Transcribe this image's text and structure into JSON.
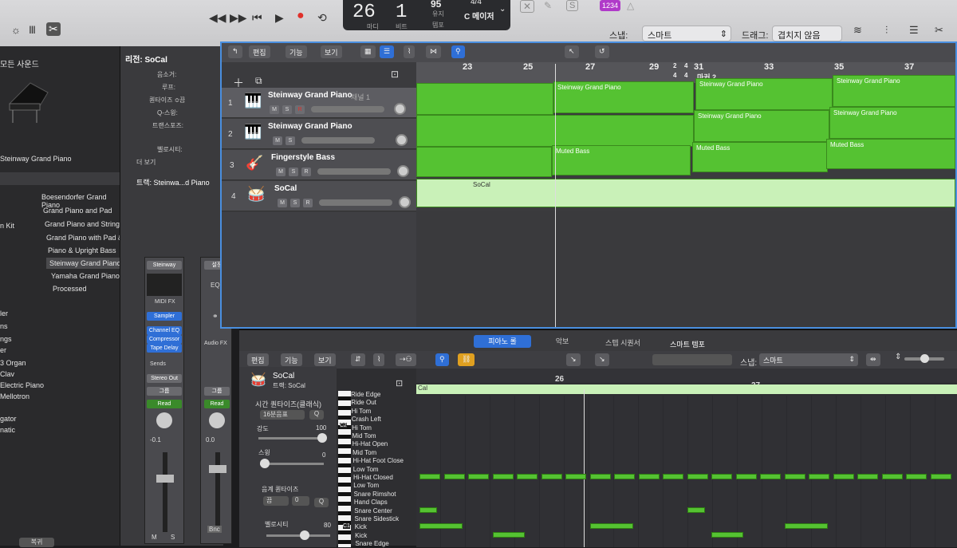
{
  "transport": {
    "bar": "26",
    "beat": "1",
    "bar_label": "마디",
    "beat_label": "비트",
    "tempo": "95",
    "tempo_label": "템포",
    "keep_label": "유지",
    "signature": "4/4",
    "key": "C 메이저",
    "counter": "1234"
  },
  "toolbar_right": {
    "snap_label": "스냅:",
    "snap_value": "스마트",
    "drag_label": "드래그:",
    "drag_value": "겹치지 않음"
  },
  "library": {
    "header": "모든 사운드",
    "instrument_name": "Steinway Grand Piano",
    "items": [
      {
        "label": "Boesendorfer Grand Piano"
      },
      {
        "label": "Grand Piano and Pad"
      },
      {
        "label": "Grand Piano and Strings"
      },
      {
        "label": "Grand Piano with Pad & C..."
      },
      {
        "label": "Piano & Upright Bass"
      },
      {
        "label": "Steinway Grand Piano"
      },
      {
        "label": "Yamaha Grand Piano"
      },
      {
        "label": "Processed"
      }
    ],
    "left_fragments": [
      "n Kit",
      "ler",
      "ns",
      "ngs",
      "er",
      "3 Organ",
      "Clav",
      "Electric Piano",
      "Mellotron",
      "gator",
      "natic"
    ],
    "footer": "복귀"
  },
  "inspector": {
    "region_title": "리전: SoCal",
    "mute": "음소거:",
    "loop": "루프:",
    "quantize": "퀀타이즈 ≎",
    "quantize_value": "끔",
    "q_swing": "Q-스윙:",
    "transpose": "트랜스포즈:",
    "velocity": "벨로시티:",
    "more": "더 보기",
    "track_title": "트랙: Steinwa...d Piano",
    "plugin_name": "Steinway",
    "settings": "설정",
    "eq": "EQ",
    "midi_fx": "MIDI FX",
    "sampler": "Sampler",
    "fx": [
      "Channel EQ",
      "Compressor",
      "Tape Delay"
    ],
    "audio_fx": "Audio FX",
    "sends": "Sends",
    "stereo_out": "Stereo Out",
    "group": "그룹",
    "read": "Read",
    "pan_a": "-0.1",
    "pan_b": "0.0",
    "bnc": "Bnc",
    "m": "M",
    "s": "S"
  },
  "tracks_window": {
    "menu": [
      "편집",
      "기능",
      "보기"
    ],
    "ruler": [
      "23",
      "25",
      "27",
      "29",
      "31",
      "33",
      "35",
      "37"
    ],
    "marker": "마커 2",
    "signature_marks": [
      "2",
      "4",
      "4",
      "4"
    ],
    "tracks": [
      {
        "num": "1",
        "name": "Steinway Grand Piano",
        "sub": "채널 1",
        "regions": [
          "Steinway Grand Piano",
          "Steinway Grand Piano",
          "Steinway Grand Piano"
        ]
      },
      {
        "num": "2",
        "name": "Steinway Grand Piano",
        "regions": [
          "Steinway Grand Piano",
          "Steinway Grand Piano"
        ]
      },
      {
        "num": "3",
        "name": "Fingerstyle Bass",
        "regions": [
          "Muted Bass",
          "Muted Bass",
          "Muted Bass"
        ]
      },
      {
        "num": "4",
        "name": "SoCal",
        "regions": [
          "SoCal"
        ]
      }
    ],
    "msr": [
      "M",
      "S",
      "R"
    ]
  },
  "editor": {
    "tabs": [
      "피아노 롤",
      "악보",
      "스텝 시퀀서",
      "스마트 템포"
    ],
    "menu": [
      "편집",
      "기능",
      "보기"
    ],
    "region_name": "SoCal",
    "track_line": "트랙: SoCal",
    "time_quantize": "시간 퀀타이즈(클래식)",
    "quantize_value": "16분음표",
    "q": "Q",
    "strength": "강도",
    "strength_value": "100",
    "swing": "스윙",
    "swing_value": "0",
    "scale_quantize": "음계 퀀타이즈",
    "scale_value": "끔",
    "scale_offset": "0",
    "velocity": "벨로시티",
    "velocity_value": "80",
    "snap_label": "스냅:",
    "snap_value": "스마트",
    "ruler": [
      "26",
      "27"
    ],
    "region_label": "Cal",
    "c2": "C2",
    "c1": "C1",
    "lanes": [
      "Ride Edge",
      "Ride Out",
      "Hi Tom",
      "Crash Left",
      "Hi Tom",
      "Mid Tom",
      "Hi-Hat Open",
      "Mid Tom",
      "Hi-Hat Foot Close",
      "Low Tom",
      "Hi-Hat Closed",
      "Low Tom",
      "Snare Rimshot",
      "Hand Claps",
      "Snare Center",
      "Snare Sidestick",
      "Kick",
      "Kick",
      "Snare Edge"
    ]
  }
}
